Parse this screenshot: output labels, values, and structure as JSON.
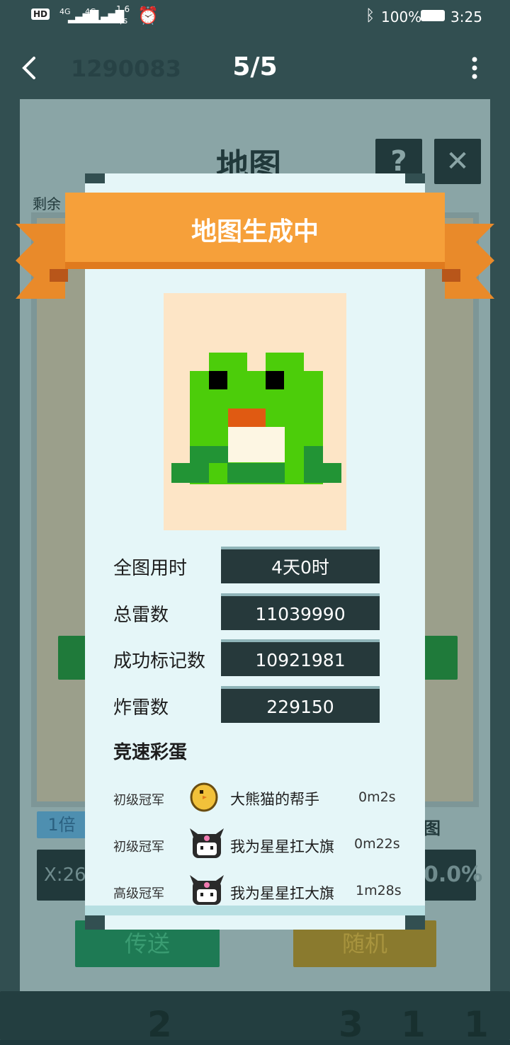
{
  "status_bar": {
    "network_hd": "HD",
    "sim1": "4G",
    "sim2": "4G",
    "speed_value": "1.6",
    "speed_unit": "K/s",
    "battery": "100%",
    "time": "3:25"
  },
  "nav": {
    "page_counter": "5/5"
  },
  "background_game": {
    "player_id": "1290083",
    "title": "地图",
    "remaining_label": "剩余",
    "zoom_label": "1倍",
    "map_label": "图",
    "coord_label": "X:26",
    "percent": "0.0%",
    "teleport_button": "传送",
    "random_button": "随机",
    "bottom_numbers": [
      "2",
      "3",
      "1",
      "1"
    ]
  },
  "modal": {
    "title": "地图生成中",
    "stats": [
      {
        "label": "全图用时",
        "value": "4天0时"
      },
      {
        "label": "总雷数",
        "value": "11039990"
      },
      {
        "label": "成功标记数",
        "value": "10921981"
      },
      {
        "label": "炸雷数",
        "value": "229150"
      }
    ],
    "easter_egg_title": "竞速彩蛋",
    "champions": [
      {
        "rank": "初级冠军",
        "name": "大熊猫的帮手",
        "time": "0m2s",
        "avatar": "chick-avatar-icon"
      },
      {
        "rank": "初级冠军",
        "name": "我为星星扛大旗",
        "time": "0m22s",
        "avatar": "kuromi-avatar-icon"
      },
      {
        "rank": "高级冠军",
        "name": "我为星星扛大旗",
        "time": "1m28s",
        "avatar": "kuromi-avatar-icon"
      }
    ]
  },
  "colors": {
    "ribbon": "#f6a03a",
    "ribbon_dark": "#e07a1e",
    "modal_bg": "#e5f6f8",
    "stat_box": "#26393b",
    "frog_green": "#4ccd0a",
    "frog_dark_green": "#229435"
  }
}
